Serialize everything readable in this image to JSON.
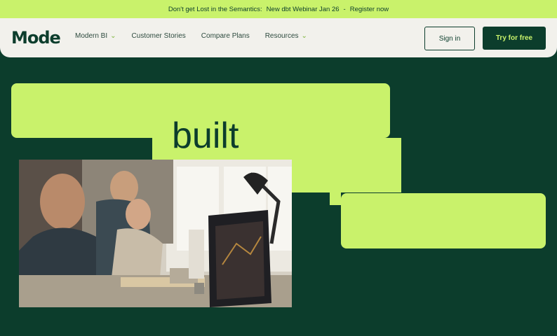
{
  "banner": {
    "text": "Don't get Lost in the Semantics:",
    "webinar": "New dbt Webinar Jan 26",
    "separator": "-",
    "register": "Register now"
  },
  "nav": {
    "logo": "Mode",
    "items": [
      {
        "label": "Modern BI",
        "has_dropdown": true
      },
      {
        "label": "Customer Stories",
        "has_dropdown": false
      },
      {
        "label": "Compare Plans",
        "has_dropdown": false
      },
      {
        "label": "Resources",
        "has_dropdown": true
      }
    ],
    "signin": "Sign in",
    "try": "Try for free"
  },
  "hero": {
    "word": "built"
  },
  "colors": {
    "brand_dark": "#0c3d2c",
    "brand_lime": "#c9f26b",
    "nav_bg": "#f2f1ec"
  }
}
